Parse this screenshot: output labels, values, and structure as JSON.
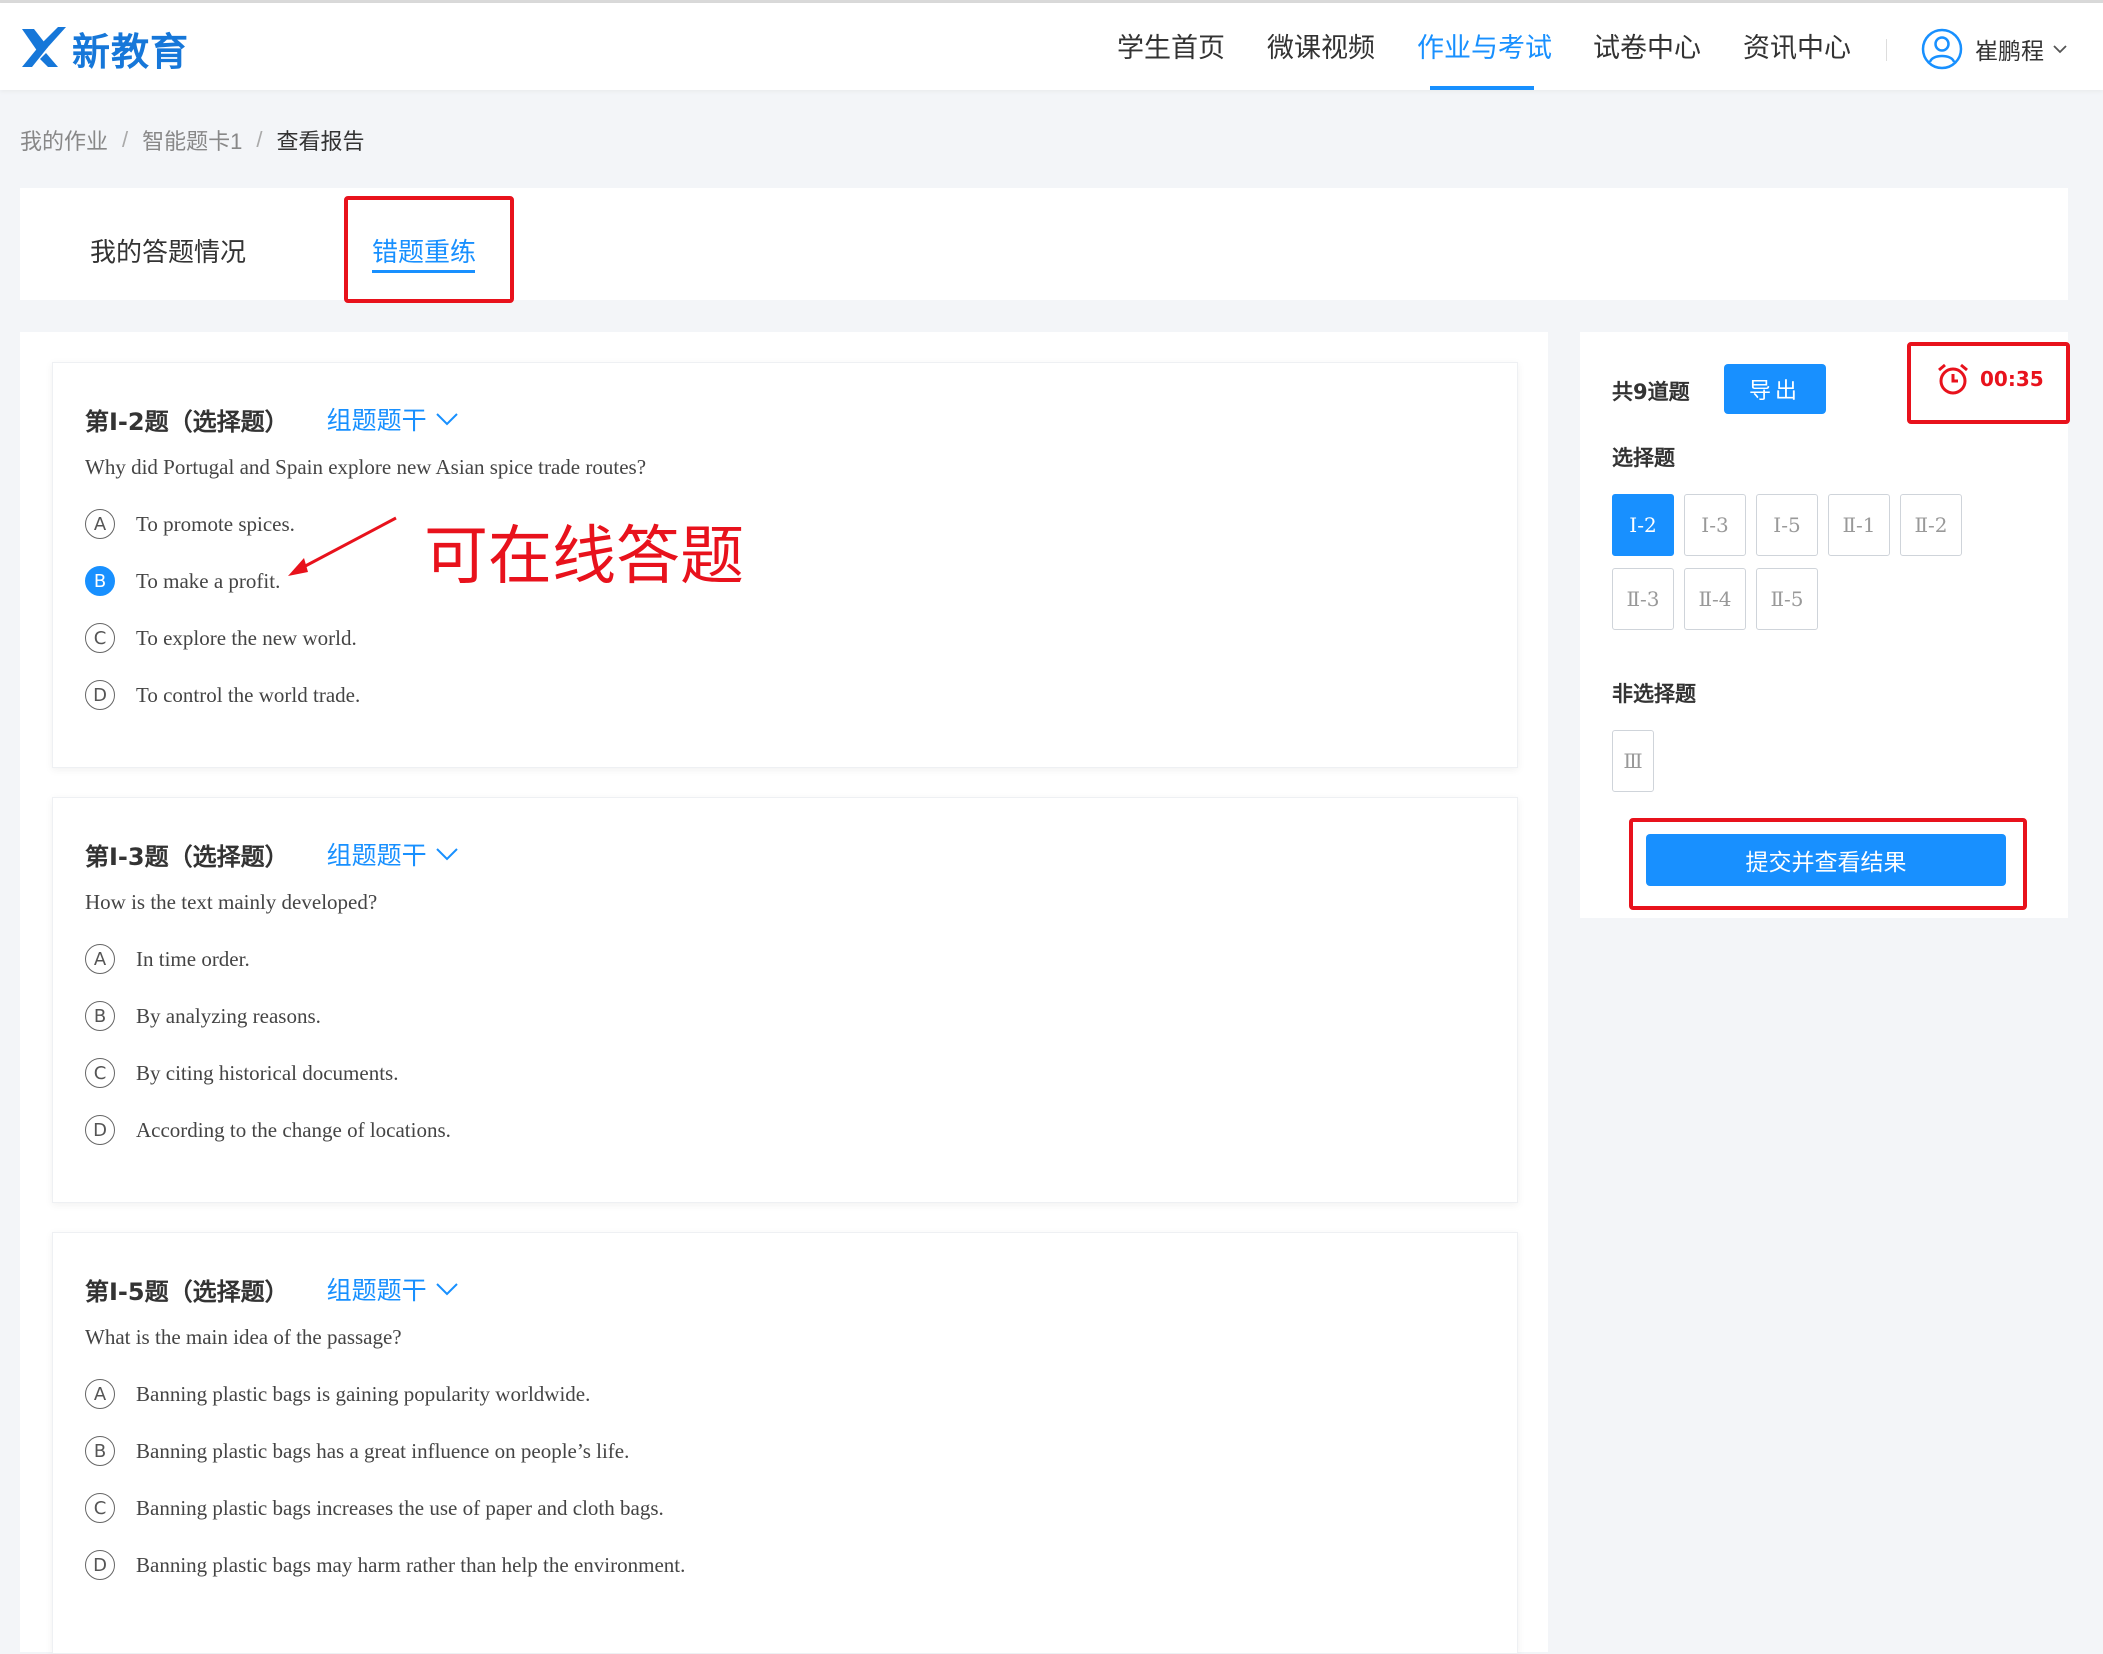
{
  "header": {
    "logo_text": "新教育",
    "nav": [
      {
        "label": "学生首页"
      },
      {
        "label": "微课视频"
      },
      {
        "label": "作业与考试"
      },
      {
        "label": "试卷中心"
      },
      {
        "label": "资讯中心"
      }
    ],
    "active_nav": "作业与考试",
    "user_name": "崔鹏程"
  },
  "breadcrumb": {
    "items": [
      "我的作业",
      "智能题卡1"
    ],
    "current": "查看报告",
    "separator": "/"
  },
  "tabs": {
    "answer_status": "我的答题情况",
    "wrong_retry": "错题重练"
  },
  "annotation": {
    "online_answer": "可在线答题"
  },
  "questions": [
    {
      "title": "第Ⅰ-2题（选择题）",
      "group_label": "组题题干",
      "stem": "Why did Portugal and Spain explore new Asian spice trade routes?",
      "options": [
        {
          "letter": "A",
          "text": "To promote spices."
        },
        {
          "letter": "B",
          "text": "To make a profit."
        },
        {
          "letter": "C",
          "text": "To explore the new world."
        },
        {
          "letter": "D",
          "text": "To control the world trade."
        }
      ],
      "selected": "B"
    },
    {
      "title": "第Ⅰ-3题（选择题）",
      "group_label": "组题题干",
      "stem": "How is the text mainly developed?",
      "options": [
        {
          "letter": "A",
          "text": "In time order."
        },
        {
          "letter": "B",
          "text": "By analyzing reasons."
        },
        {
          "letter": "C",
          "text": "By citing historical documents."
        },
        {
          "letter": "D",
          "text": "According to the change of locations."
        }
      ],
      "selected": ""
    },
    {
      "title": "第Ⅰ-5题（选择题）",
      "group_label": "组题题干",
      "stem": "What is the main idea of the passage?",
      "options": [
        {
          "letter": "A",
          "text": "Banning plastic bags is gaining popularity worldwide."
        },
        {
          "letter": "B",
          "text": "Banning plastic bags has a great influence on people’s life."
        },
        {
          "letter": "C",
          "text": "Banning plastic bags increases the use of paper and cloth bags."
        },
        {
          "letter": "D",
          "text": "Banning plastic bags may harm rather than help the environment."
        }
      ],
      "selected": ""
    }
  ],
  "side": {
    "total": "共9道题",
    "export_label": "导出",
    "timer": "00:35",
    "choice_label": "选择题",
    "choice_numbers": [
      "Ⅰ-2",
      "Ⅰ-3",
      "Ⅰ-5",
      "Ⅱ-1",
      "Ⅱ-2",
      "Ⅱ-3",
      "Ⅱ-4",
      "Ⅱ-5"
    ],
    "active_number": "Ⅰ-2",
    "non_choice_label": "非选择题",
    "non_choice_numbers": [
      "Ⅲ"
    ],
    "submit_label": "提交并查看结果"
  },
  "colors": {
    "primary": "#1890ff",
    "annotation_red": "#e8121c",
    "logo_blue": "#1677d9"
  },
  "icons": {
    "logo": "xin-logo-icon",
    "user": "user-avatar-icon",
    "chevron": "chevron-down-icon",
    "timer": "alarm-clock-icon"
  }
}
